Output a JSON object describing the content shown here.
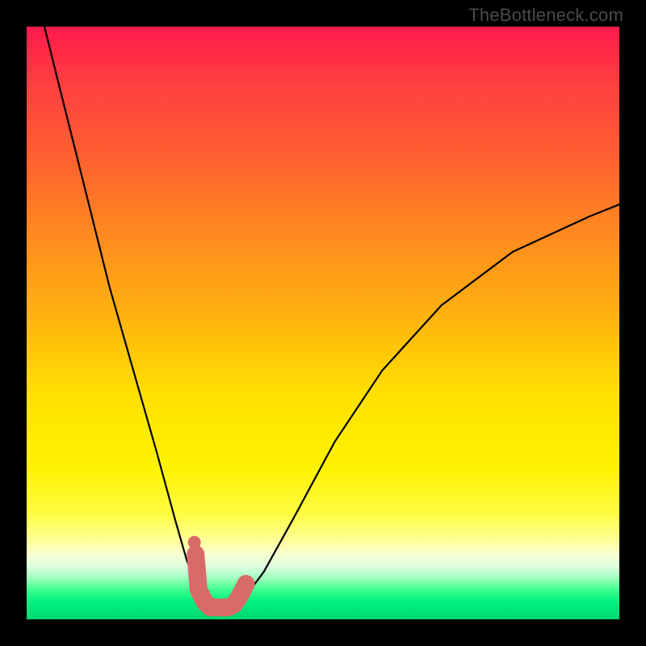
{
  "watermark": "TheBottleneck.com",
  "chart_data": {
    "type": "line",
    "title": "",
    "xlabel": "",
    "ylabel": "",
    "xlim": [
      0,
      100
    ],
    "ylim": [
      0,
      100
    ],
    "grid": false,
    "legend": false,
    "annotations": [],
    "series": [
      {
        "name": "bottleneck-curve",
        "color": "#000000",
        "x": [
          3,
          6,
          10,
          14,
          18,
          22,
          25,
          27,
          29,
          30,
          31,
          32,
          33.5,
          35,
          37,
          40,
          45,
          52,
          60,
          70,
          82,
          95,
          100
        ],
        "y": [
          100,
          88,
          72,
          56,
          42,
          28,
          17,
          10,
          5,
          3,
          2,
          2,
          2,
          2.5,
          4,
          8,
          17,
          30,
          42,
          53,
          62,
          68,
          70
        ]
      },
      {
        "name": "highlight-band",
        "color": "#d96a6a",
        "x": [
          28.5,
          29,
          30,
          31,
          32,
          33,
          34,
          35,
          36,
          37
        ],
        "y": [
          11,
          5,
          3,
          2,
          2,
          2,
          2,
          2.5,
          4,
          6
        ]
      },
      {
        "name": "highlight-dot",
        "color": "#d96a6a",
        "x": [
          28.3
        ],
        "y": [
          13
        ]
      }
    ],
    "background_gradient": {
      "direction": "vertical",
      "stops": [
        {
          "pos": 0.0,
          "color": "#ff1a4d"
        },
        {
          "pos": 0.35,
          "color": "#ff8a20"
        },
        {
          "pos": 0.62,
          "color": "#ffe000"
        },
        {
          "pos": 0.87,
          "color": "#ffffa0"
        },
        {
          "pos": 0.95,
          "color": "#40ff90"
        },
        {
          "pos": 1.0,
          "color": "#00d870"
        }
      ]
    }
  }
}
